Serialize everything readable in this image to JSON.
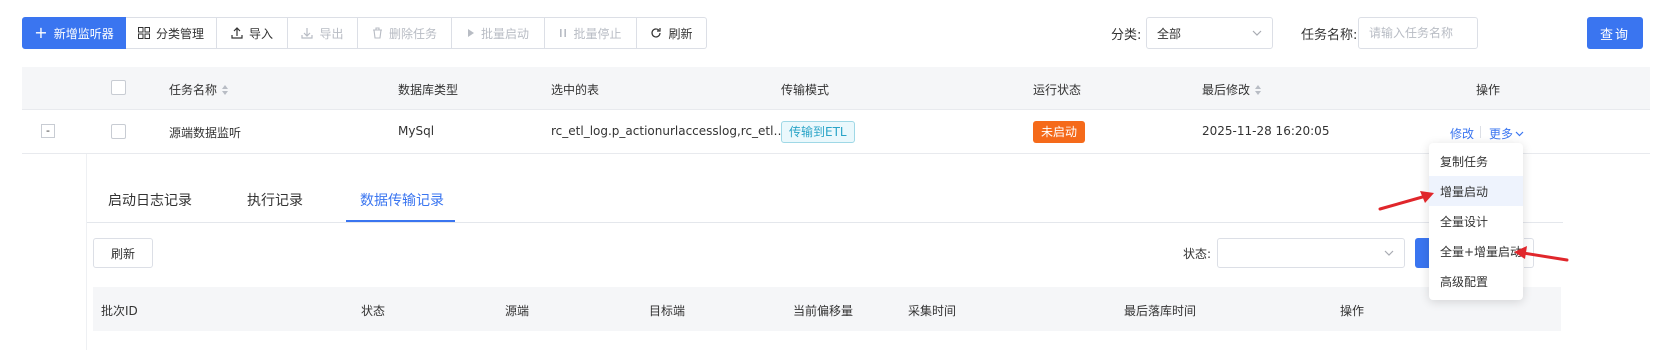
{
  "toolbar": {
    "add_label": "新增监听器",
    "category_label": "分类管理",
    "import_label": "导入",
    "export_label": "导出",
    "delete_label": "删除任务",
    "batch_start_label": "批量启动",
    "batch_stop_label": "批量停止",
    "refresh_label": "刷新"
  },
  "filters": {
    "category_label": "分类:",
    "category_value": "全部",
    "task_name_label": "任务名称:",
    "task_name_placeholder": "请输入任务名称",
    "query_label": "查询"
  },
  "table": {
    "headers": {
      "name": "任务名称",
      "db_type": "数据库类型",
      "tables": "选中的表",
      "mode": "传输模式",
      "status": "运行状态",
      "modified": "最后修改",
      "actions": "操作"
    },
    "rows": [
      {
        "expand": "-",
        "name": "源端数据监听",
        "db_type": "MySql",
        "tables": "rc_etl_log.p_actionurlaccesslog,rc_etl…",
        "mode": "传输到ETL",
        "status": "未启动",
        "modified": "2025-11-28 16:20:05",
        "edit": "修改",
        "more": "更多"
      }
    ]
  },
  "subpanel": {
    "tabs": [
      "启动日志记录",
      "执行记录",
      "数据传输记录"
    ],
    "active_tab": 2,
    "refresh_label": "刷新",
    "status_label": "状态:",
    "status_value": "",
    "headers": [
      "批次ID",
      "状态",
      "源端",
      "目标端",
      "当前偏移量",
      "采集时间",
      "最后落库时间",
      "操作"
    ]
  },
  "more_menu": {
    "items": [
      "复制任务",
      "增量启动",
      "全量设计",
      "全量+增量启动",
      "高级配置"
    ],
    "highlighted": 1
  },
  "colors": {
    "primary": "#3a75f0",
    "status_stopped": "#f56a1a",
    "etl_tag": "#2aa4c7",
    "annotation_arrow": "#e0262b"
  }
}
